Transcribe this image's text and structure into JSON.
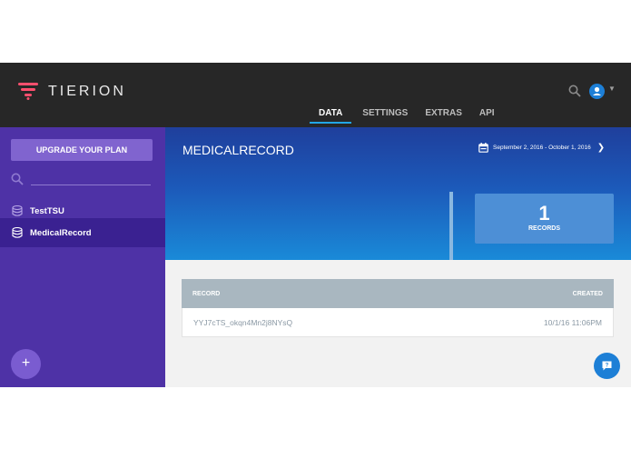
{
  "brand": {
    "name": "TIERION"
  },
  "tabs": [
    {
      "label": "DATA",
      "active": true
    },
    {
      "label": "SETTINGS",
      "active": false
    },
    {
      "label": "EXTRAS",
      "active": false
    },
    {
      "label": "API",
      "active": false
    }
  ],
  "sidebar": {
    "upgrade_label": "UPGRADE YOUR PLAN",
    "search_placeholder": "",
    "items": [
      {
        "label": "TestTSU",
        "active": false
      },
      {
        "label": "MedicalRecord",
        "active": true
      }
    ],
    "add_label": "+"
  },
  "hero": {
    "title": "MEDICALRECORD",
    "date_range": "September 2, 2016 - October 1, 2016",
    "stat_value": "1",
    "stat_label": "RECORDS"
  },
  "table": {
    "headers": {
      "record": "RECORD",
      "created": "CREATED"
    },
    "rows": [
      {
        "record": "YYJ7cTS_okqn4Mn2j8NYsQ",
        "created": "10/1/16 11:06PM"
      }
    ]
  },
  "colors": {
    "brand_accent": "#ff4f6e",
    "sidebar": "#4e32a6",
    "tab_underline": "#22a6e6",
    "help_button": "#1d7fd6"
  }
}
